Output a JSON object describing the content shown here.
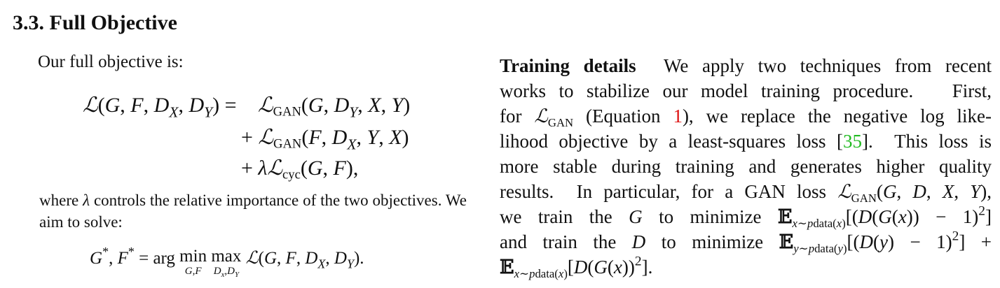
{
  "section": {
    "number": "3.3.",
    "title": "Full Objective"
  },
  "intro": "Our full objective is:",
  "equation": {
    "lhs": "ℒ(G, F, D_X, D_Y) =",
    "term1": "ℒ_GAN(G, D_Y, X, Y)",
    "term2": "+ ℒ_GAN(F, D_X, Y, X)",
    "term3": "+ λℒ_cyc(G, F),",
    "gan_subscript": "GAN",
    "cyc_subscript": "cyc"
  },
  "where_text": {
    "part1": "where",
    "lambda": "λ",
    "part2": "controls the relative importance of the two objectives. We aim to solve:"
  },
  "final_equation": {
    "lhs": "G*, F* = arg",
    "min_op": "min",
    "min_under": "G,F",
    "max_op": "max",
    "max_under": "Dx,DY",
    "rhs": "ℒ(G, F, D_X, D_Y)."
  },
  "training": {
    "heading": "Training details",
    "lines": [
      "We apply two techniques from recent",
      "works to stabilize our model training procedure.   First,",
      "for ℒ_GAN (Equation 1), we replace the negative log like-",
      "lihood objective by a least-squares loss [35].  This loss is",
      "more stable during training and generates higher quality",
      "results.  In particular, for a GAN loss ℒ_GAN(G, D, X, Y),",
      "we train the G to minimize E_{x∼p_data(x)}[(D(G(x)) − 1)²]",
      "and train the D to minimize E_{y∼p_data(y)}[(D(y) − 1)²] +",
      "E_{x∼p_data(x)}[D(G(x))²]."
    ],
    "ref_equation": "1",
    "ref_citation": "35"
  }
}
